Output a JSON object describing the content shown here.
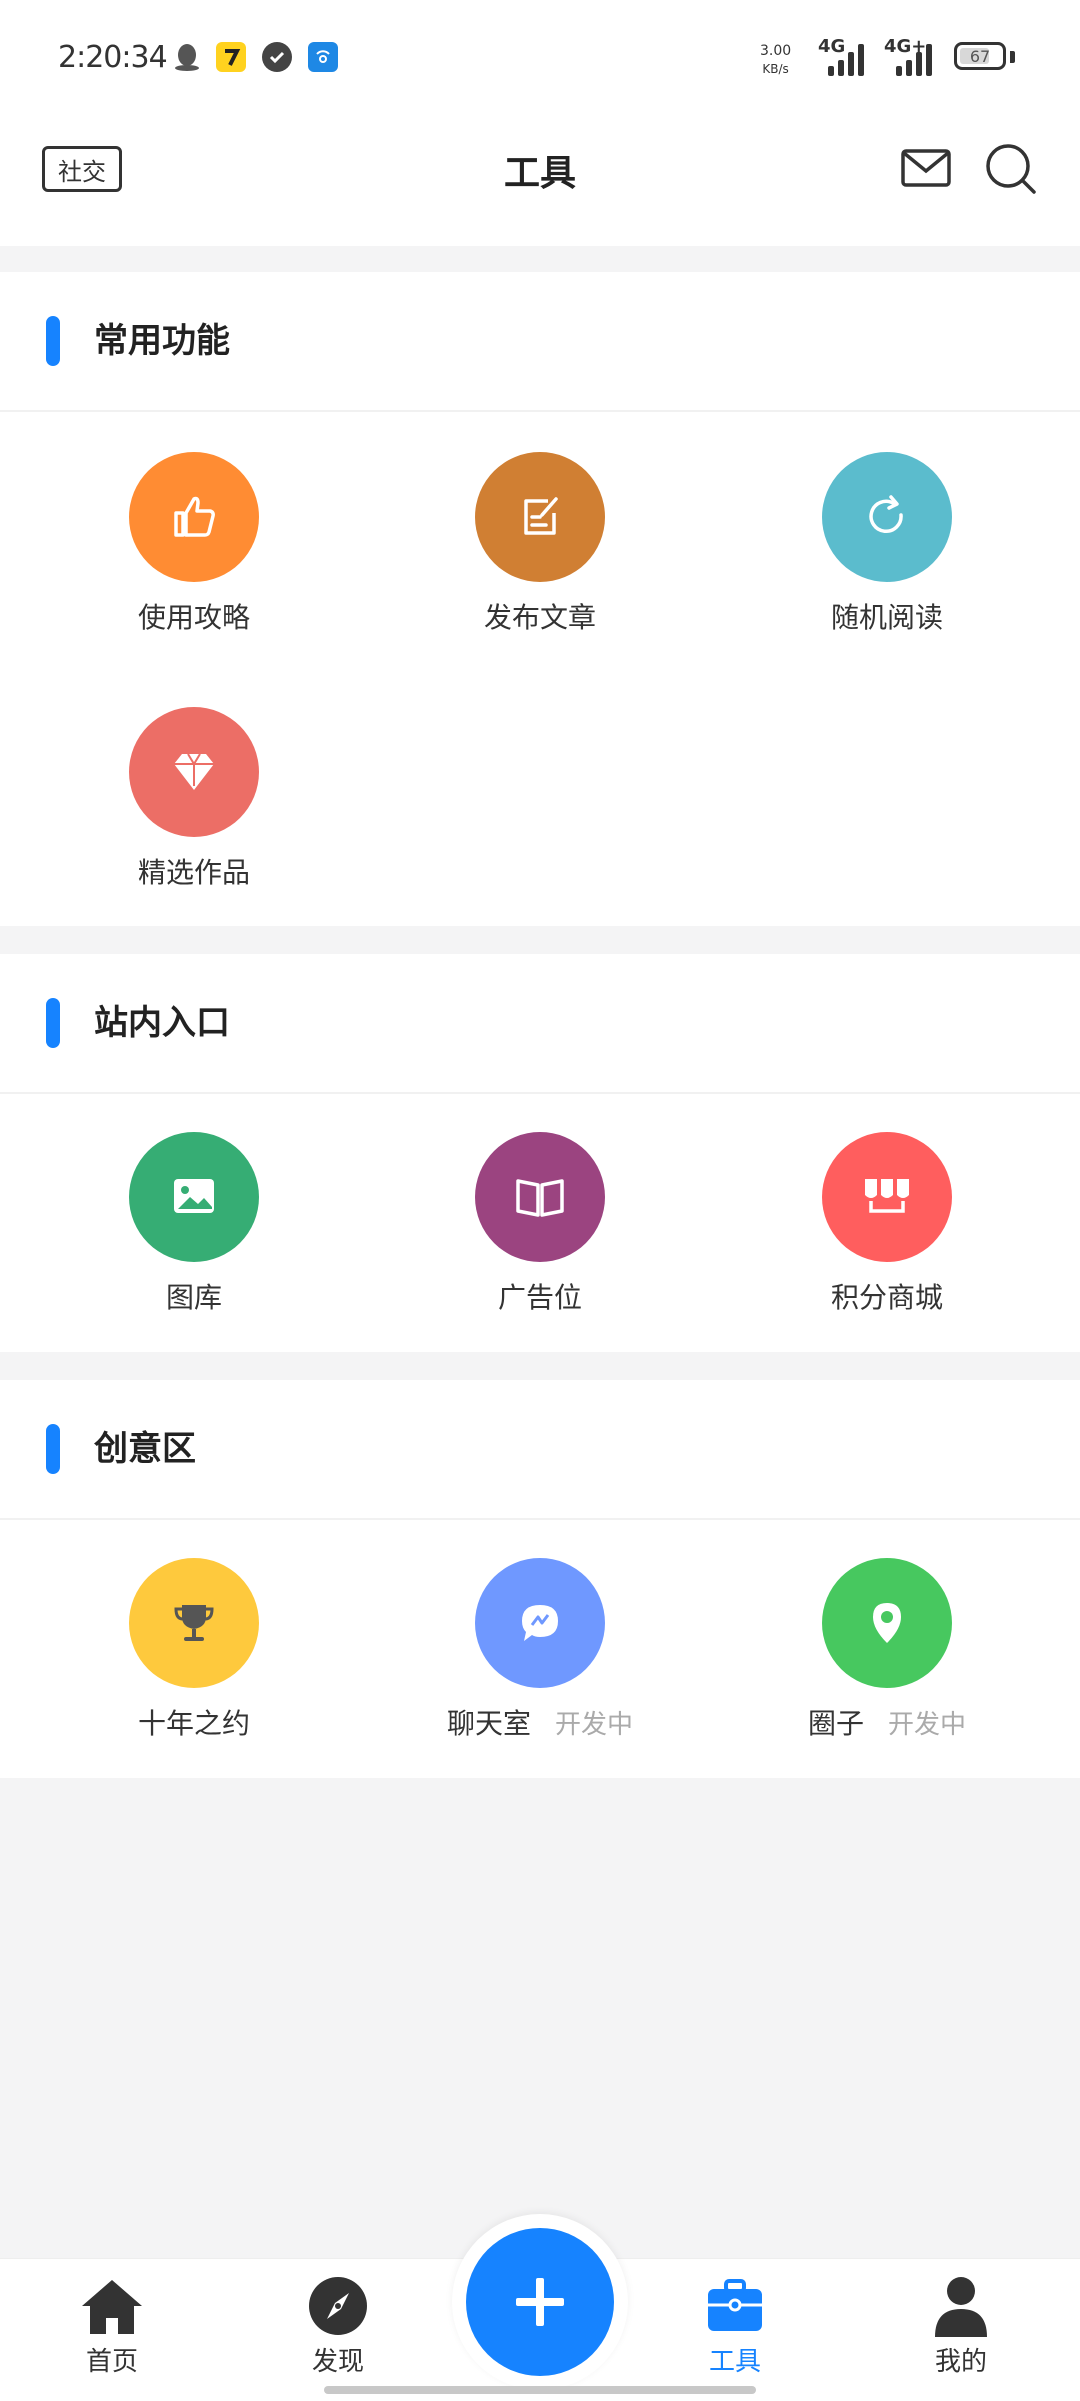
{
  "status_bar": {
    "time": "2:20:34",
    "speed_value": "3.00",
    "speed_unit": "KB/s",
    "network_1": "4G",
    "network_2": "4G+",
    "battery": "67"
  },
  "header": {
    "left_tag": "社交",
    "title": "工具"
  },
  "sections": [
    {
      "title": "常用功能",
      "items": [
        {
          "label": "使用攻略",
          "icon": "thumbs-up-icon",
          "color": "#ff8c33"
        },
        {
          "label": "发布文章",
          "icon": "edit-document-icon",
          "color": "#d07f33"
        },
        {
          "label": "随机阅读",
          "icon": "refresh-icon",
          "color": "#5bbccd"
        },
        {
          "label": "精选作品",
          "icon": "diamond-icon",
          "color": "#ec6e66"
        }
      ]
    },
    {
      "title": "站内入口",
      "items": [
        {
          "label": "图库",
          "icon": "image-icon",
          "color": "#36ad74"
        },
        {
          "label": "广告位",
          "icon": "open-book-icon",
          "color": "#9b4480"
        },
        {
          "label": "积分商城",
          "icon": "shop-awning-icon",
          "color": "#ff5e5e"
        }
      ]
    },
    {
      "title": "创意区",
      "items": [
        {
          "label": "十年之约",
          "icon": "trophy-icon",
          "color": "#fec93d"
        },
        {
          "label": "聊天室",
          "status": "开发中",
          "icon": "chat-bubble-icon",
          "color": "#6f98ff"
        },
        {
          "label": "圈子",
          "status": "开发中",
          "icon": "location-pin-icon",
          "color": "#47c85f"
        }
      ]
    }
  ],
  "tab_bar": {
    "items": [
      {
        "label": "首页",
        "icon": "home-icon"
      },
      {
        "label": "发现",
        "icon": "compass-icon"
      },
      {
        "label": "工具",
        "icon": "toolbox-icon",
        "active": true
      },
      {
        "label": "我的",
        "icon": "user-icon"
      }
    ],
    "fab_icon": "plus-icon"
  },
  "colors": {
    "accent": "#1683ff",
    "page_bg": "#f4f4f5",
    "text_primary": "#222222",
    "text_muted": "#aaaaaa"
  }
}
